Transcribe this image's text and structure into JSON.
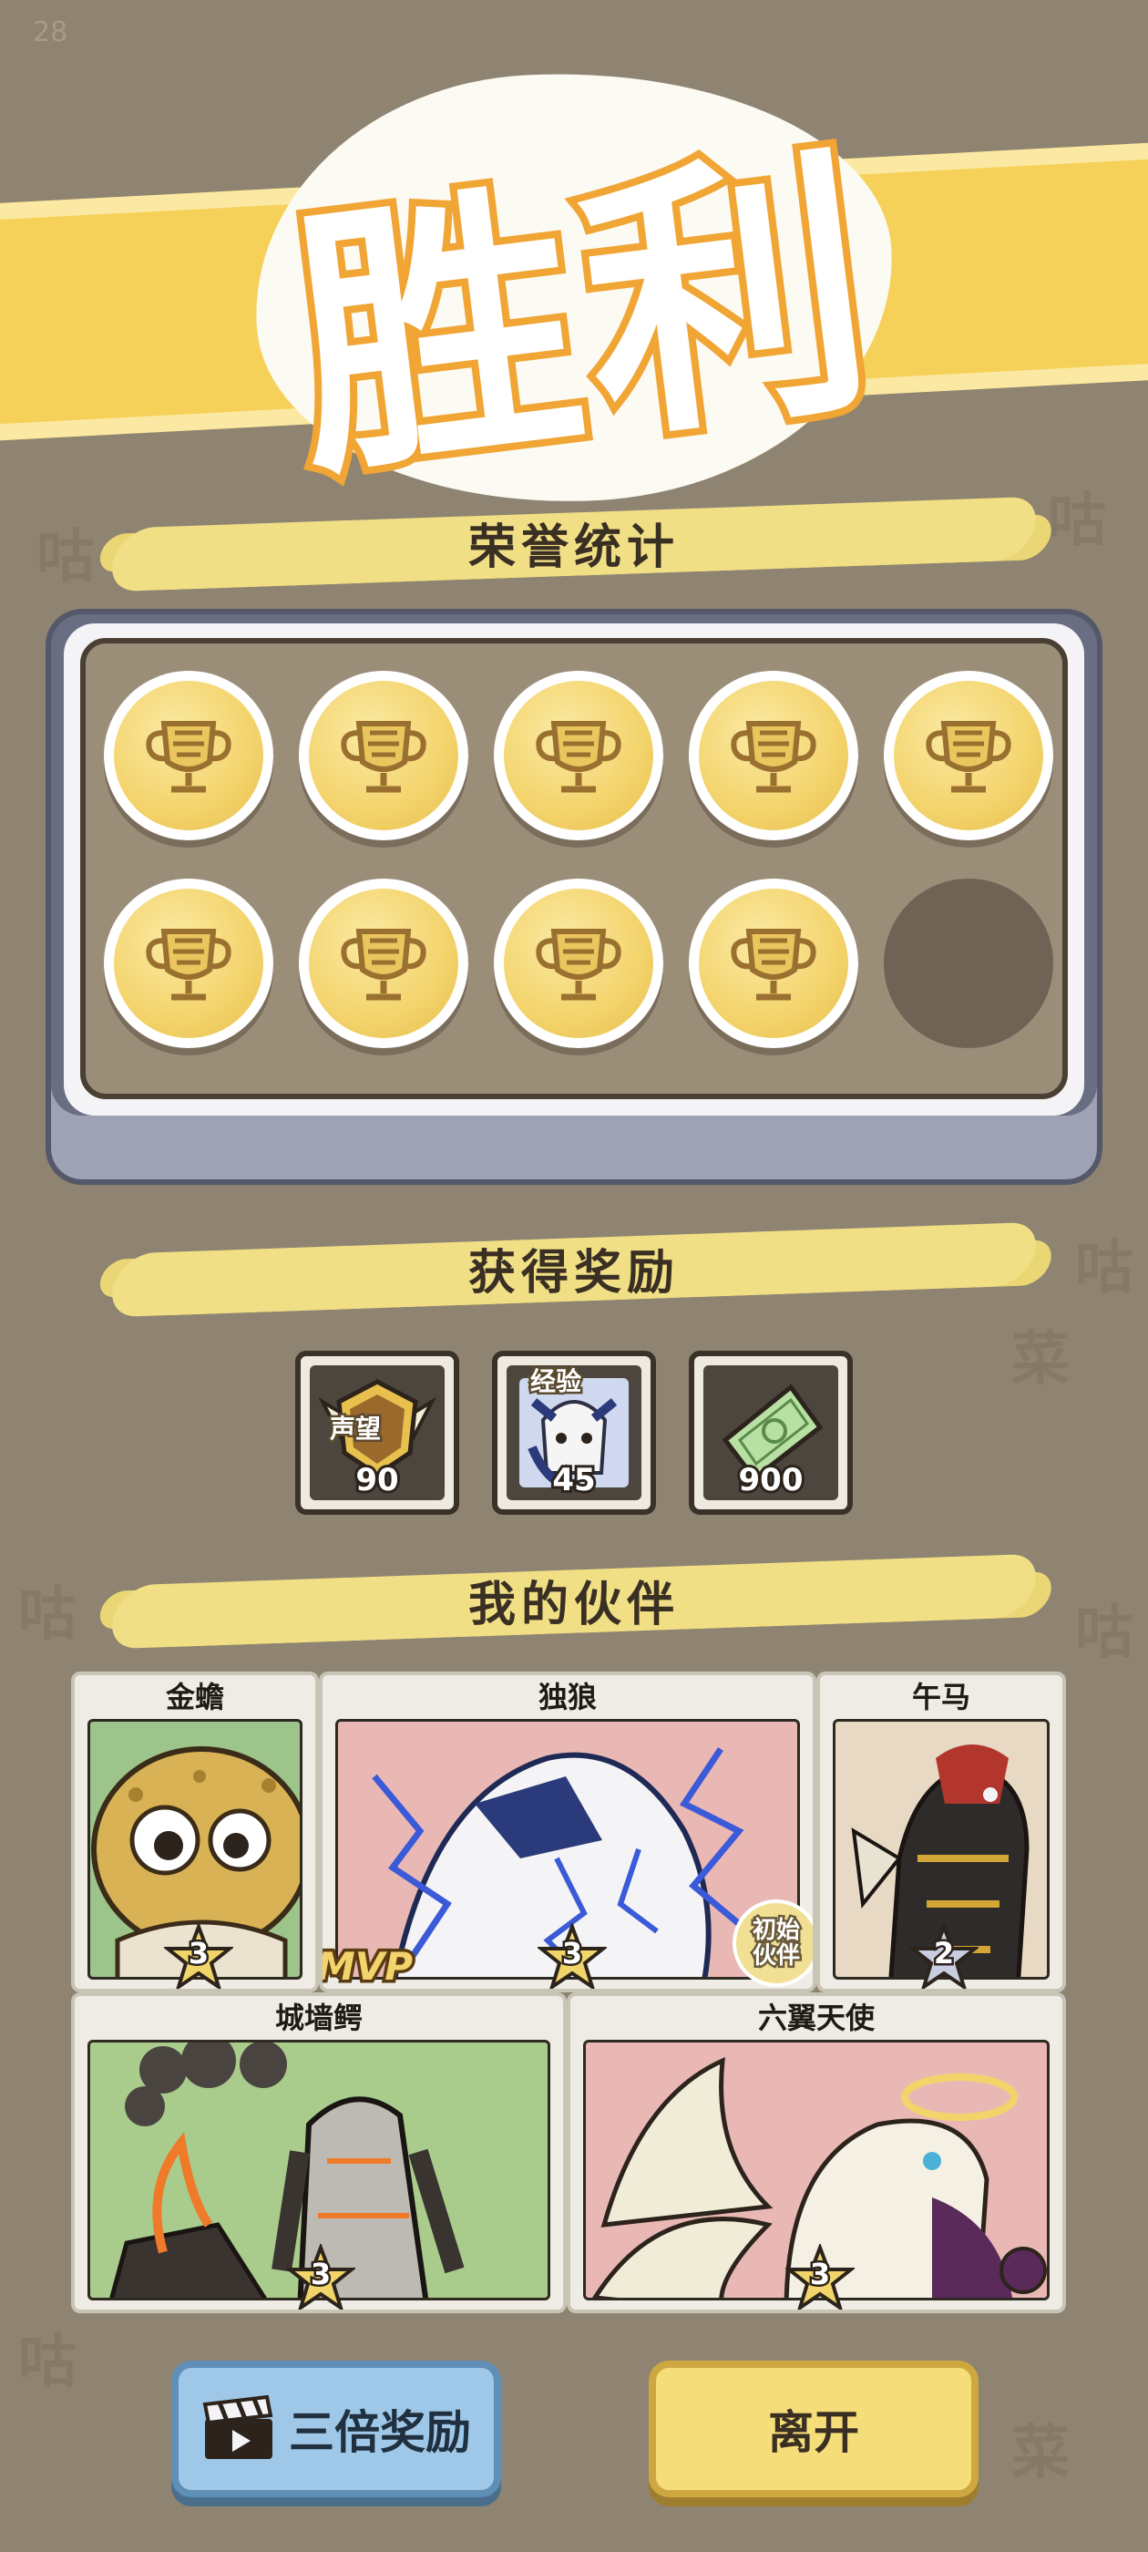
{
  "status_bar": {
    "corner_number": "28"
  },
  "background": {
    "watermark_chars": [
      "咕",
      "咕",
      "菜",
      "咕",
      "咕",
      "菜",
      "咕",
      "咕"
    ]
  },
  "banner": {
    "title": "胜利"
  },
  "honor_stats": {
    "title": "荣誉统计",
    "medals": [
      {
        "icon": "trophy-icon",
        "earned": true
      },
      {
        "icon": "trophy-icon",
        "earned": true
      },
      {
        "icon": "trophy-icon",
        "earned": true
      },
      {
        "icon": "trophy-icon",
        "earned": true
      },
      {
        "icon": "trophy-icon",
        "earned": true
      },
      {
        "icon": "trophy-icon",
        "earned": true
      },
      {
        "icon": "trophy-icon",
        "earned": true
      },
      {
        "icon": "trophy-icon",
        "earned": true
      },
      {
        "icon": "trophy-icon",
        "earned": true
      },
      {
        "icon": "empty-slot",
        "earned": false
      }
    ]
  },
  "rewards": {
    "title": "获得奖励",
    "items": [
      {
        "icon": "reputation-badge-icon",
        "tag": "声望",
        "qty": "90"
      },
      {
        "icon": "experience-character-icon",
        "tag": "经验",
        "qty": "45"
      },
      {
        "icon": "cash-note-icon",
        "tag": "",
        "qty": "900"
      }
    ]
  },
  "partners": {
    "title": "我的伙伴",
    "cards": [
      {
        "name": "金蟾",
        "stars": "3",
        "badge": ""
      },
      {
        "name": "独狼",
        "stars": "3",
        "badge": "MVP"
      },
      {
        "name": "午马",
        "stars": "2",
        "badge": ""
      },
      {
        "name": "城墙鳄",
        "stars": "3",
        "badge": ""
      },
      {
        "name": "六翼天使",
        "stars": "3",
        "badge": ""
      }
    ],
    "initial_tag": "初始\n伙伴"
  },
  "buttons": {
    "triple_reward": "三倍奖励",
    "leave": "离开"
  },
  "colors": {
    "background": "#8f8471",
    "banner_yellow": "#f6d15a",
    "title_outline": "#f0a534",
    "medal_gold": "#f3d36b",
    "button_blue": "#9fc8e8",
    "button_yellow": "#f5dd79"
  }
}
